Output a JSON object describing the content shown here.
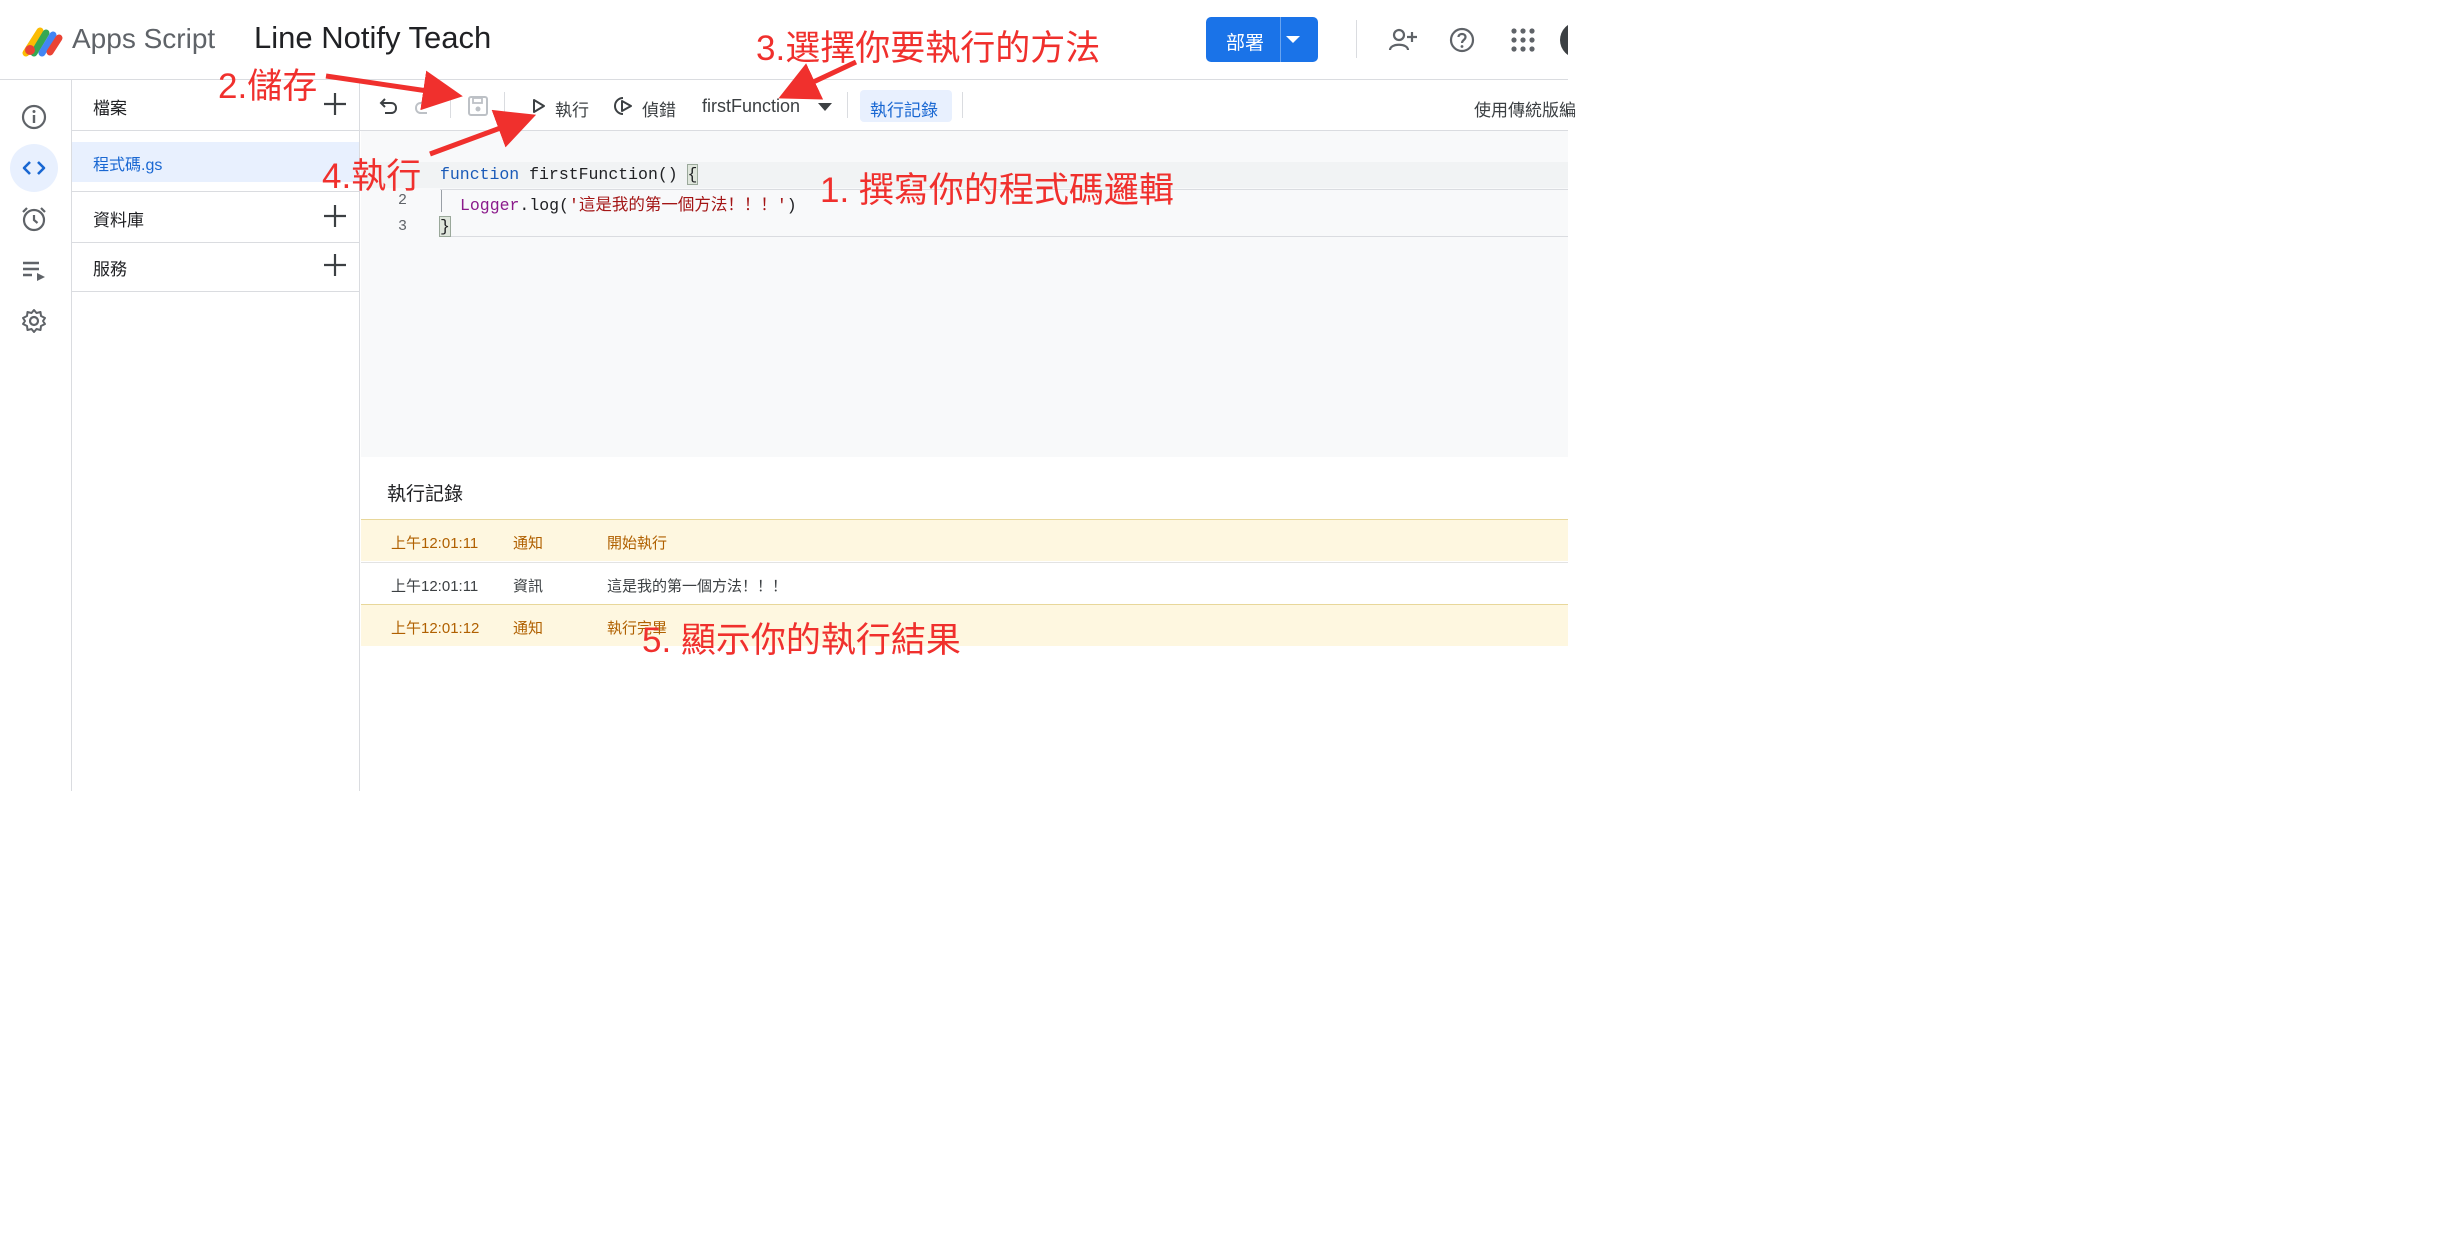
{
  "header": {
    "app_name": "Apps Script",
    "project_title": "Line Notify Teach",
    "deploy_label": "部署"
  },
  "sidebar_panels": {
    "files_label": "檔案",
    "file_name": "程式碼.gs",
    "libraries_label": "資料庫",
    "services_label": "服務"
  },
  "toolbar": {
    "run_label": "執行",
    "debug_label": "偵錯",
    "function_selected": "firstFunction",
    "exec_log_label": "執行記錄",
    "legacy_label": "使用傳統版編"
  },
  "editor": {
    "line_numbers": [
      "",
      "2",
      "3"
    ],
    "line1": {
      "keyword": "function",
      "name": " firstFunction() ",
      "brace": "{"
    },
    "line2": {
      "object": "Logger",
      "method": ".log(",
      "string": "'這是我的第一個方法！！！'",
      "close": ")"
    },
    "line3": {
      "brace": "}"
    }
  },
  "log": {
    "title": "執行記錄",
    "rows": [
      {
        "time": "上午12:01:11",
        "level": "通知",
        "message": "開始執行"
      },
      {
        "time": "上午12:01:11",
        "level": "資訊",
        "message": "這是我的第一個方法！！！"
      },
      {
        "time": "上午12:01:12",
        "level": "通知",
        "message": "執行完畢"
      }
    ]
  },
  "annotations": {
    "step1": "1. 撰寫你的程式碼邏輯",
    "step2": "2.儲存",
    "step3": "3.選擇你要執行的方法",
    "step4": "4.執行",
    "step5": "5. 顯示你的執行結果"
  },
  "colors": {
    "accent": "#1a73e8",
    "annotation": "#f0302d",
    "notice_bg": "#fef7e0",
    "notice_text": "#b06000"
  }
}
